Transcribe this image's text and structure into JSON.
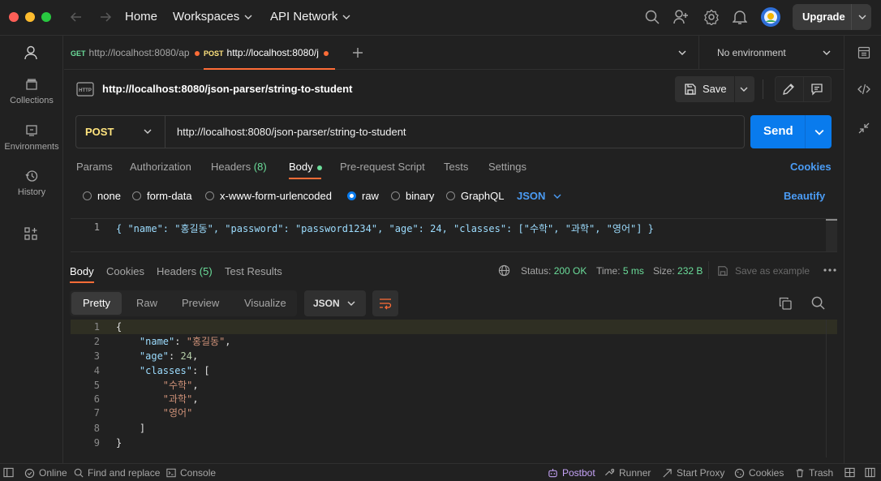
{
  "topbar": {
    "home": "Home",
    "workspaces": "Workspaces",
    "api_network": "API Network",
    "upgrade": "Upgrade"
  },
  "sidebar": {
    "items": [
      {
        "label": "Collections",
        "icon": "collections-icon"
      },
      {
        "label": "Environments",
        "icon": "environments-icon"
      },
      {
        "label": "History",
        "icon": "history-icon"
      }
    ]
  },
  "tabs": [
    {
      "method": "GET",
      "title": "http://localhost:8080/ap"
    },
    {
      "method": "POST",
      "title": "http://localhost:8080/j"
    }
  ],
  "environment": "No environment",
  "request": {
    "title": "http://localhost:8080/json-parser/string-to-student",
    "save_label": "Save",
    "method": "POST",
    "url": "http://localhost:8080/json-parser/string-to-student",
    "send_label": "Send",
    "tabs": [
      "Params",
      "Authorization",
      "Headers",
      "Body",
      "Pre-request Script",
      "Tests",
      "Settings"
    ],
    "headers_count": "(8)",
    "cookies_label": "Cookies",
    "body_options": [
      "none",
      "form-data",
      "x-www-form-urlencoded",
      "raw",
      "binary",
      "GraphQL"
    ],
    "body_format": "JSON",
    "beautify_label": "Beautify",
    "body_line_no": "1",
    "body_text": "{ \"name\": \"홍길동\", \"password\": \"password1234\", \"age\": 24, \"classes\": [\"수학\", \"과학\", \"영어\"] }"
  },
  "response": {
    "tabs": [
      "Body",
      "Cookies",
      "Headers",
      "Test Results"
    ],
    "headers_count": "(5)",
    "status_label": "Status:",
    "status_value": "200 OK",
    "time_label": "Time:",
    "time_value": "5 ms",
    "size_label": "Size:",
    "size_value": "232 B",
    "save_example": "Save as example",
    "views": [
      "Pretty",
      "Raw",
      "Preview",
      "Visualize"
    ],
    "format": "JSON",
    "lines": [
      "1",
      "2",
      "3",
      "4",
      "5",
      "6",
      "7",
      "8",
      "9"
    ],
    "json": {
      "open": "{",
      "name_key": "\"name\"",
      "name_val": "\"홍길동\"",
      "age_key": "\"age\"",
      "age_val": "24",
      "classes_key": "\"classes\"",
      "c1": "\"수학\"",
      "c2": "\"과학\"",
      "c3": "\"영어\"",
      "close_arr": "]",
      "close": "}"
    }
  },
  "statusbar": {
    "online": "Online",
    "find": "Find and replace",
    "console": "Console",
    "postbot": "Postbot",
    "runner": "Runner",
    "proxy": "Start Proxy",
    "cookies": "Cookies",
    "trash": "Trash"
  },
  "colors": {
    "accent": "#097bed",
    "post": "#ffe47e",
    "get": "#6bdd9a",
    "status_ok": "#6bdd9a",
    "unsaved_dot": "#ff6c37"
  }
}
